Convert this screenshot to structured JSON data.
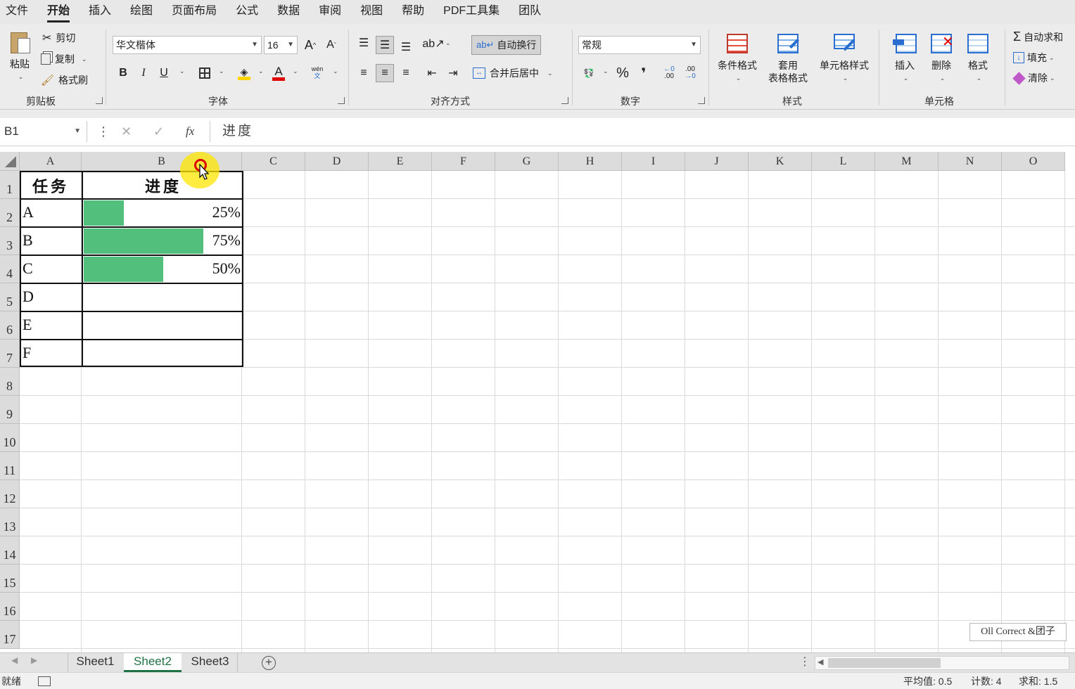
{
  "menu": {
    "items": [
      "文件",
      "开始",
      "插入",
      "绘图",
      "页面布局",
      "公式",
      "数据",
      "审阅",
      "视图",
      "帮助",
      "PDF工具集",
      "团队"
    ],
    "active": "开始"
  },
  "ribbon": {
    "clipboard": {
      "paste": "粘贴",
      "cut": "剪切",
      "copy": "复制",
      "format_painter": "格式刷",
      "label": "剪贴板"
    },
    "font": {
      "font_name": "华文楷体",
      "font_size": "16",
      "bold": "B",
      "italic": "I",
      "underline": "U",
      "grow": "A",
      "shrink": "A",
      "phonetic_top": "wén",
      "phonetic_bottom": "文",
      "label": "字体"
    },
    "alignment": {
      "wrap_text": "自动换行",
      "merge_center": "合并后居中",
      "label": "对齐方式"
    },
    "number": {
      "format": "常规",
      "percent": "%",
      "comma": "❜",
      "increase_decimal": ".00",
      "decrease_decimal": ".00",
      "label": "数字"
    },
    "styles": {
      "conditional": "条件格式",
      "table_format_1": "套用",
      "table_format_2": "表格格式",
      "cell_styles": "单元格样式",
      "label": "样式"
    },
    "cells": {
      "insert": "插入",
      "delete": "删除",
      "format": "格式",
      "label": "单元格"
    },
    "editing": {
      "autosum": "自动求和",
      "fill": "填充",
      "clear": "清除"
    }
  },
  "formula_bar": {
    "name_box": "B1",
    "cancel": "✕",
    "enter": "✓",
    "fx": "fx",
    "content": "进度"
  },
  "columns": [
    "A",
    "B",
    "C",
    "D",
    "E",
    "F",
    "G",
    "H",
    "I",
    "J",
    "K",
    "L",
    "M",
    "N",
    "O"
  ],
  "rows": [
    "1",
    "2",
    "3",
    "4",
    "5",
    "6",
    "7",
    "8",
    "9",
    "10",
    "11",
    "12",
    "13",
    "14",
    "15",
    "16",
    "17"
  ],
  "table": {
    "header_task": "任务",
    "header_progress": "进度",
    "rows": [
      {
        "task": "A",
        "progress_label": "25%",
        "progress": 0.25
      },
      {
        "task": "B",
        "progress_label": "75%",
        "progress": 0.75
      },
      {
        "task": "C",
        "progress_label": "50%",
        "progress": 0.5
      },
      {
        "task": "D",
        "progress_label": "",
        "progress": 0
      },
      {
        "task": "E",
        "progress_label": "",
        "progress": 0
      },
      {
        "task": "F",
        "progress_label": "",
        "progress": 0
      }
    ],
    "bar_color": "#52bf7c"
  },
  "watermark": "Oll Correct &团子",
  "sheets": {
    "tabs": [
      "Sheet1",
      "Sheet2",
      "Sheet3"
    ],
    "active": "Sheet2"
  },
  "status": {
    "ready": "就绪",
    "average": "平均值: 0.5",
    "count": "计数: 4",
    "sum": "求和: 1.5"
  }
}
